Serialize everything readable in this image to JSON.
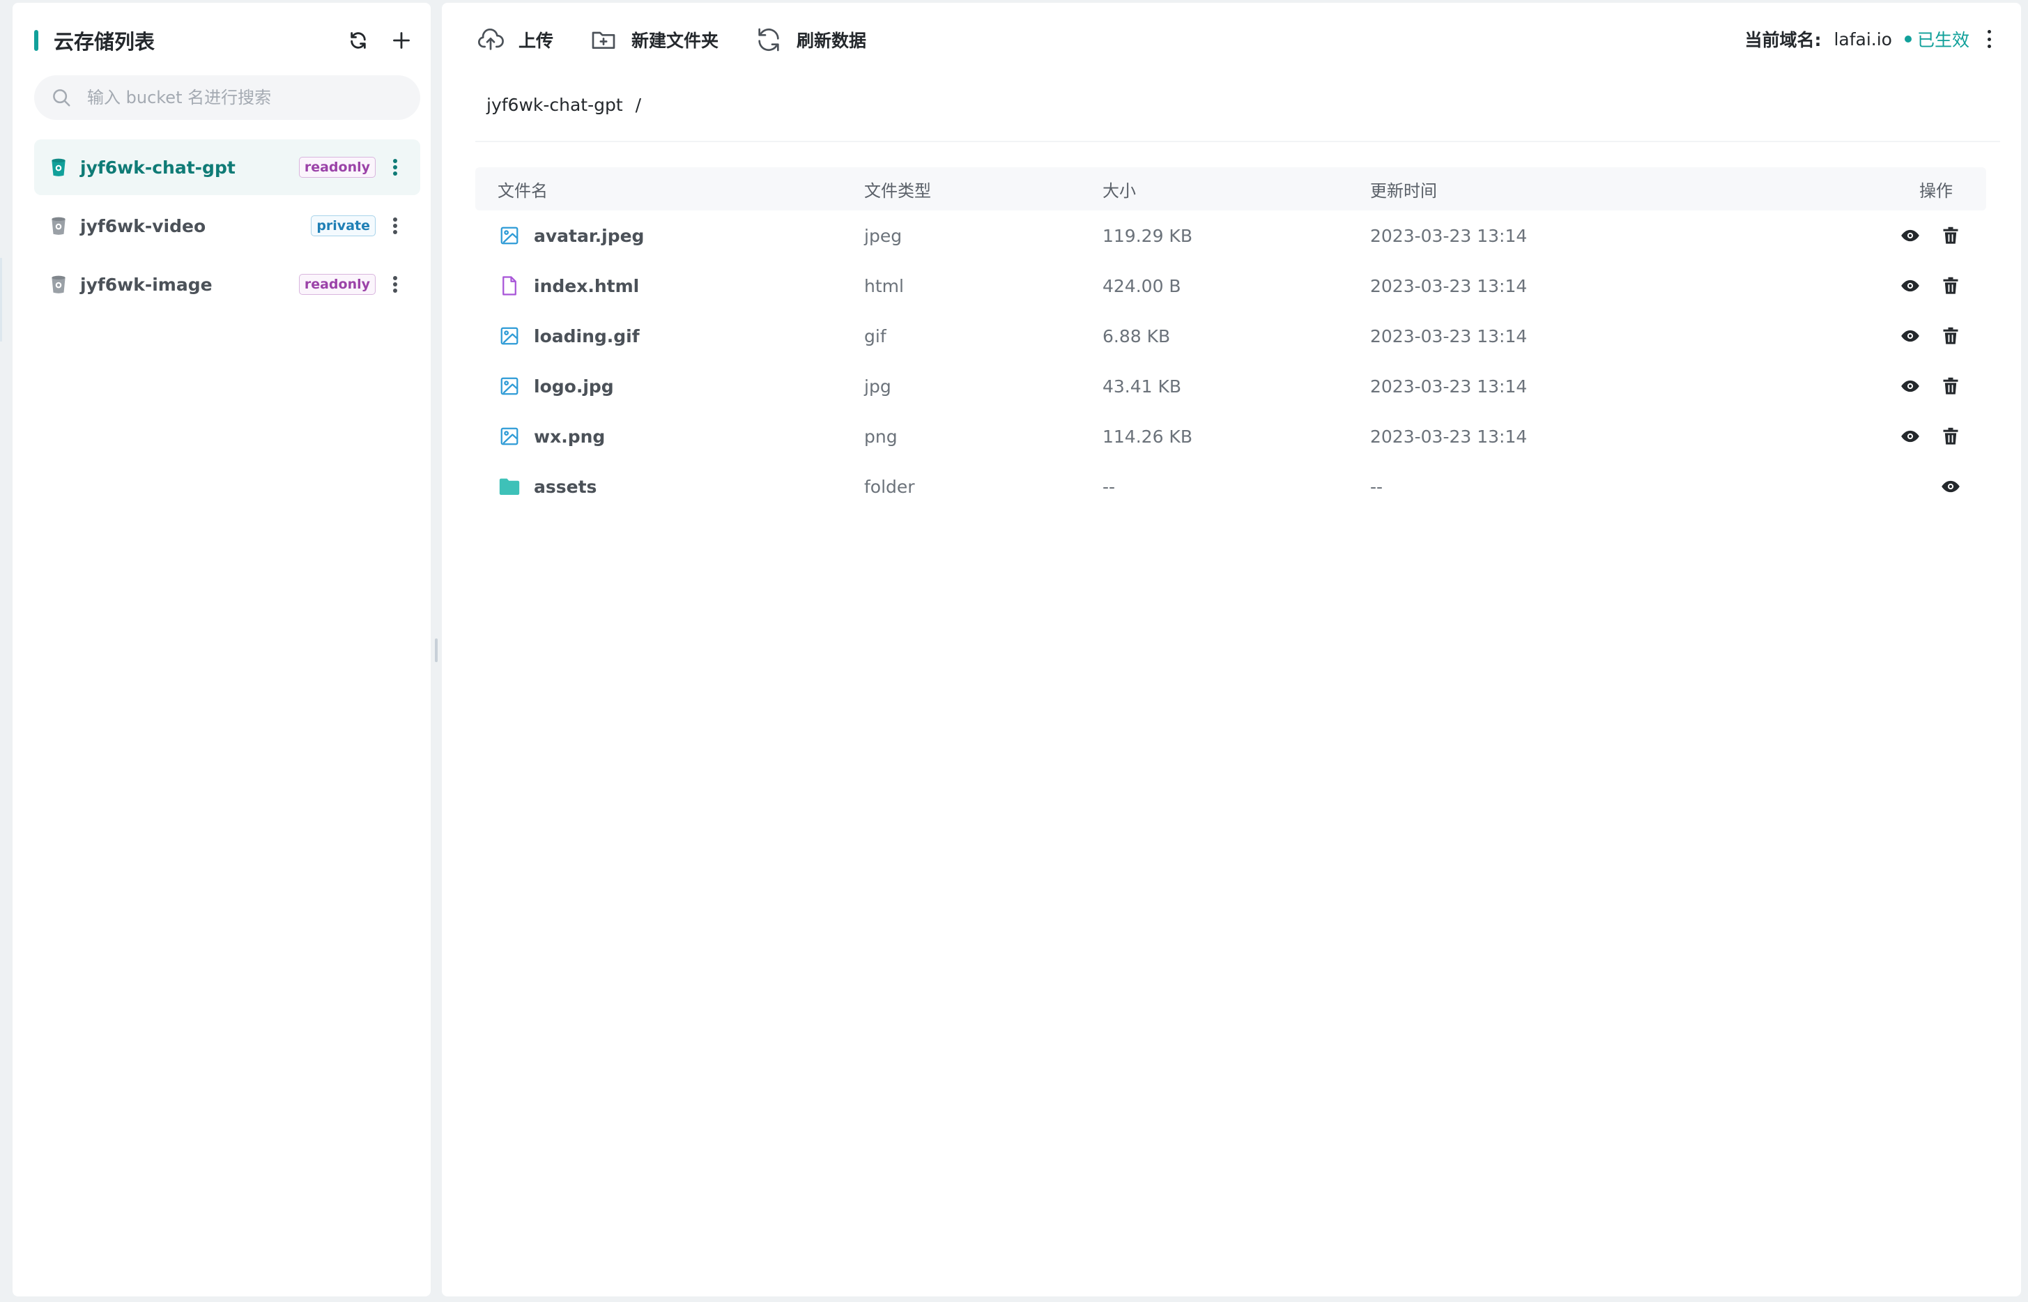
{
  "sidebar": {
    "title": "云存储列表",
    "search_placeholder": "输入 bucket 名进行搜索",
    "buckets": [
      {
        "name": "jyf6wk-chat-gpt",
        "policy": "readonly",
        "active": true
      },
      {
        "name": "jyf6wk-video",
        "policy": "private",
        "active": false
      },
      {
        "name": "jyf6wk-image",
        "policy": "readonly",
        "active": false
      }
    ]
  },
  "toolbar": {
    "upload": "上传",
    "new_folder": "新建文件夹",
    "refresh": "刷新数据"
  },
  "domain": {
    "label": "当前域名:",
    "value": "lafai.io",
    "status": "已生效"
  },
  "breadcrumb": {
    "bucket": "jyf6wk-chat-gpt",
    "separator": "/"
  },
  "table": {
    "columns": {
      "name": "文件名",
      "type": "文件类型",
      "size": "大小",
      "updated": "更新时间",
      "actions": "操作"
    },
    "rows": [
      {
        "name": "avatar.jpeg",
        "type": "jpeg",
        "size": "119.29 KB",
        "updated": "2023-03-23 13:14",
        "icon": "image-icon"
      },
      {
        "name": "index.html",
        "type": "html",
        "size": "424.00 B",
        "updated": "2023-03-23 13:14",
        "icon": "file-icon"
      },
      {
        "name": "loading.gif",
        "type": "gif",
        "size": "6.88 KB",
        "updated": "2023-03-23 13:14",
        "icon": "image-icon"
      },
      {
        "name": "logo.jpg",
        "type": "jpg",
        "size": "43.41 KB",
        "updated": "2023-03-23 13:14",
        "icon": "image-icon"
      },
      {
        "name": "wx.png",
        "type": "png",
        "size": "114.26 KB",
        "updated": "2023-03-23 13:14",
        "icon": "image-icon"
      },
      {
        "name": "assets",
        "type": "folder",
        "size": "--",
        "updated": "--",
        "icon": "folder-icon"
      }
    ]
  },
  "colors": {
    "accent": "#11a09a",
    "readonly_tag": "#9b43a8",
    "private_tag": "#1f7fb5",
    "image_icon": "#2e9bd6",
    "file_icon": "#a855d8",
    "folder_icon": "#3ec1b8"
  }
}
